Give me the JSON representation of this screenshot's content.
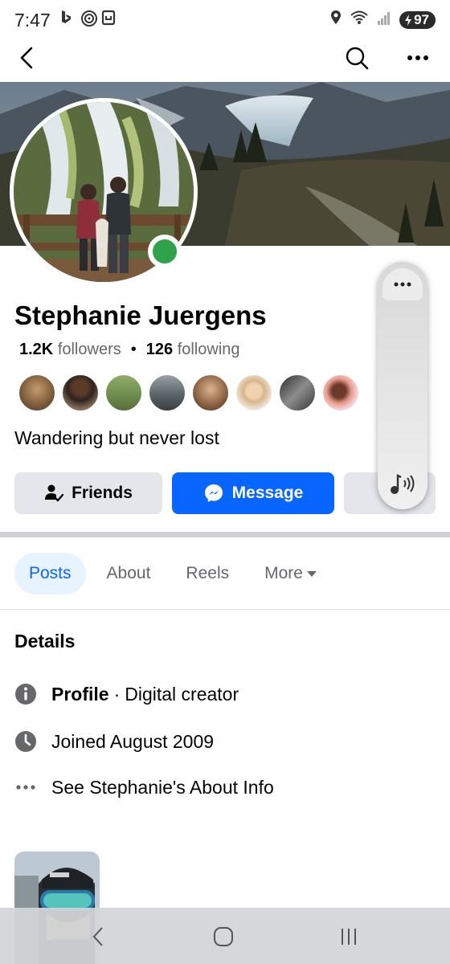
{
  "status_bar": {
    "time": "7:47",
    "battery": "97",
    "left_icons": [
      "bing-icon",
      "nfc-icon",
      "screenshot-icon"
    ],
    "right_icons": [
      "location-icon",
      "wifi-icon",
      "signal-icon",
      "battery-icon"
    ]
  },
  "nav": {
    "icons": [
      "back-icon",
      "search-icon",
      "more-dots-icon"
    ]
  },
  "profile": {
    "name": "Stephanie Juergens",
    "followers_count": "1.2K",
    "followers_label": "followers",
    "separator": "•",
    "following_count": "126",
    "following_label": "following",
    "bio": "Wandering but never lost",
    "mutual_friend_count": 8,
    "online": true
  },
  "actions": {
    "friends_label": "Friends",
    "message_label": "Message"
  },
  "tabs": [
    {
      "label": "Posts",
      "active": true
    },
    {
      "label": "About",
      "active": false
    },
    {
      "label": "Reels",
      "active": false
    },
    {
      "label": "More",
      "active": false
    }
  ],
  "details": {
    "title": "Details",
    "profile_label": "Profile",
    "profile_sep": "·",
    "profile_type": "Digital creator",
    "joined": "Joined August 2009",
    "about_link": "See Stephanie's About Info"
  },
  "colors": {
    "accent": "#0866ff",
    "online": "#31a24c",
    "tab_active_bg": "#e7f3ff",
    "button_grey": "#e4e6eb"
  }
}
